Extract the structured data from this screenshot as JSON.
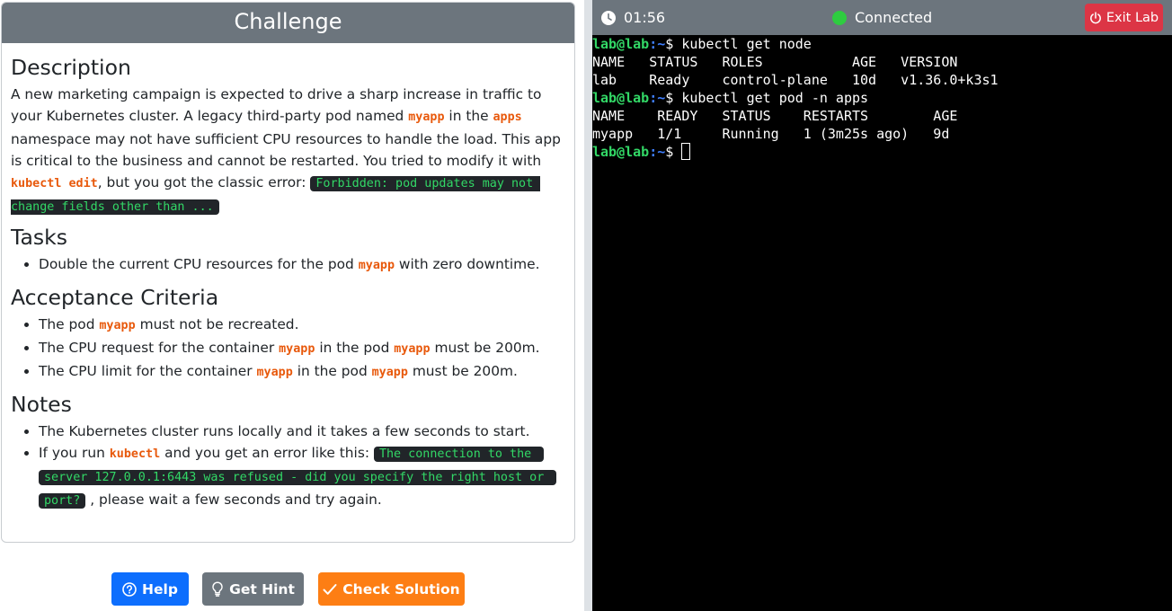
{
  "challenge": {
    "title": "Challenge",
    "description": {
      "heading": "Description",
      "t1": "A new marketing campaign is expected to drive a sharp increase in traffic to your Kubernetes cluster. A legacy third-party pod named ",
      "c1": "myapp",
      "t2": " in the ",
      "c2": "apps",
      "t3": " namespace may not have sufficient CPU resources to handle the load. This app is critical to the business and cannot be restarted. You tried to modify it with ",
      "c3": "kubectl edit",
      "t4": ", but you got the classic error: ",
      "error": "Forbidden: pod updates may not change fields other than ..."
    },
    "tasks": {
      "heading": "Tasks",
      "t1": "Double the current CPU resources for the pod ",
      "c1": "myapp",
      "t2": " with zero downtime."
    },
    "acceptance": {
      "heading": "Acceptance Criteria",
      "item1": {
        "t1": "The pod ",
        "c1": "myapp",
        "t2": " must not be recreated."
      },
      "item2": {
        "t1": "The CPU request for the container ",
        "c1": "myapp",
        "t2": " in the pod ",
        "c2": "myapp",
        "t3": " must be 200m."
      },
      "item3": {
        "t1": "The CPU limit for the container ",
        "c1": "myapp",
        "t2": " in the pod ",
        "c2": "myapp",
        "t3": " must be 200m."
      }
    },
    "notes": {
      "heading": "Notes",
      "item1": "The Kubernetes cluster runs locally and it takes a few seconds to start.",
      "item2": {
        "t1": "If you run ",
        "c1": "kubectl",
        "t2": " and you get an error like this: ",
        "error": "The connection to the server 127.0.0.1:6443 was refused - did you specify the right host or port?",
        "t3": " , please wait a few seconds and try again."
      }
    }
  },
  "buttons": {
    "help": "Help",
    "hint": "Get Hint",
    "check": "Check Solution"
  },
  "terminal_header": {
    "timer": "01:56",
    "status": "Connected",
    "exit": "Exit Lab",
    "status_color": "#2ecc40"
  },
  "terminal": {
    "prompt_user": "lab@lab",
    "prompt_path": ":~",
    "prompt_symbol": "$ ",
    "cmd1": "kubectl get node",
    "out1_header": "NAME   STATUS   ROLES           AGE   VERSION",
    "out1_row": "lab    Ready    control-plane   10d   v1.36.0+k3s1",
    "cmd2": "kubectl get pod -n apps",
    "out2_header": "NAME    READY   STATUS    RESTARTS        AGE",
    "out2_row": "myapp   1/1     Running   1 (3m25s ago)   9d"
  },
  "colors": {
    "header_gray": "#6c757d",
    "help_blue": "#0d6efd",
    "check_orange": "#fd7e14",
    "exit_red": "#dc3545",
    "code_orange": "#e8590c",
    "term_green": "#32d866"
  }
}
